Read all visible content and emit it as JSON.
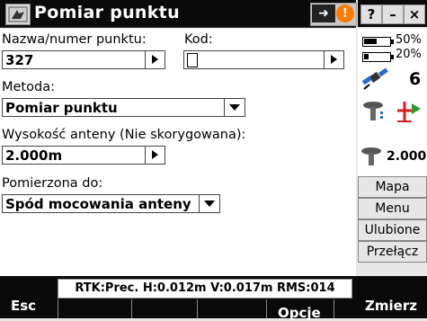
{
  "title": {
    "text": "Pomiar punktu"
  },
  "window_buttons": {
    "help": "?",
    "minimize": "–",
    "close": "×"
  },
  "form": {
    "point_label": "Nazwa/numer punktu:",
    "point_value": "327",
    "code_label": "Kod:",
    "method_label": "Metoda:",
    "method_value": "Pomiar punktu",
    "antenna_label": "Wysokość anteny (Nie skorygowana):",
    "antenna_value": "2.000m",
    "measured_label": "Pomierzona do:",
    "measured_value": "Spód mocowania anteny"
  },
  "status": {
    "battery1": "50%",
    "battery2": "20%",
    "satellites": "6",
    "antenna_height": "2.000",
    "battery1_level": 0.5,
    "battery2_level": 0.2
  },
  "side_menu": [
    "Mapa",
    "Menu",
    "Ulubione",
    "Przełącz"
  ],
  "status_line": "RTK:Prec. H:0.012m V:0.017m RMS:014",
  "bottom": {
    "esc": "Esc",
    "options": "Opcje",
    "measure": "Zmierz"
  },
  "colors": {
    "titlebar": "#0a0a0a",
    "warning": "#ff7a00",
    "accent_green": "#2a9a2a",
    "accent_red": "#d42020"
  }
}
